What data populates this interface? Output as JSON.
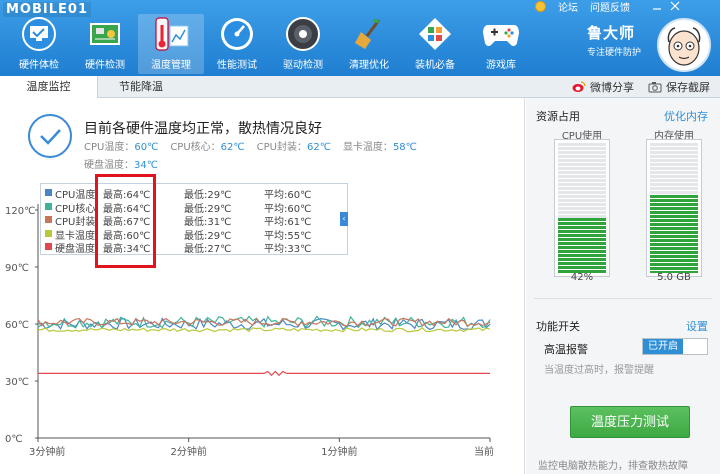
{
  "watermark": "MOBILE01",
  "title_bar": {
    "forum": "论坛",
    "feedback": "问题反馈"
  },
  "toolbar": {
    "items": [
      {
        "label": "硬件体检",
        "icon": "monitor-check-icon"
      },
      {
        "label": "硬件检测",
        "icon": "circuit-board-icon"
      },
      {
        "label": "温度管理",
        "icon": "thermometer-icon"
      },
      {
        "label": "性能测试",
        "icon": "speedometer-icon"
      },
      {
        "label": "驱动检测",
        "icon": "driver-box-icon"
      },
      {
        "label": "清理优化",
        "icon": "broom-icon"
      },
      {
        "label": "装机必备",
        "icon": "apps-grid-icon"
      },
      {
        "label": "游戏库",
        "icon": "gamepad-icon"
      }
    ],
    "active_index": 2
  },
  "brand": {
    "name": "鲁大师",
    "subtitle": "专注硬件防护"
  },
  "tabs": [
    {
      "label": "温度监控"
    },
    {
      "label": "节能降温"
    }
  ],
  "tab_actions": {
    "share": "微博分享",
    "screenshot": "保存截屏"
  },
  "status": {
    "message": "目前各硬件温度均正常，散热情况良好",
    "readings": [
      {
        "label": "CPU温度：",
        "value": "60℃"
      },
      {
        "label": "CPU核心：",
        "value": "62℃"
      },
      {
        "label": "CPU封装：",
        "value": "62℃"
      },
      {
        "label": "显卡温度：",
        "value": "58℃"
      }
    ],
    "disk": {
      "label": "硬盘温度：",
      "value": "34℃"
    }
  },
  "chart_data": {
    "type": "line",
    "y_ticks": [
      "120℃",
      "90℃",
      "60℃",
      "30℃",
      "0℃"
    ],
    "ylim": [
      0,
      120
    ],
    "x_ticks": [
      "3分钟前",
      "2分钟前",
      "1分钟前",
      "当前"
    ],
    "series": [
      {
        "name": "CPU温度",
        "color": "#4a86c6",
        "max": "最高:64℃",
        "min": "最低:29℃",
        "avg": "平均:60℃",
        "level": 60,
        "noise": 3
      },
      {
        "name": "CPU核心",
        "color": "#3fb39a",
        "max": "最高:64℃",
        "min": "最低:29℃",
        "avg": "平均:60℃",
        "level": 61,
        "noise": 3
      },
      {
        "name": "CPU封装",
        "color": "#c8765a",
        "max": "最高:67℃",
        "min": "最低:31℃",
        "avg": "平均:61℃",
        "level": 61,
        "noise": 2
      },
      {
        "name": "显卡温度",
        "color": "#b9c83a",
        "max": "最高:60℃",
        "min": "最低:29℃",
        "avg": "平均:55℃",
        "level": 57,
        "noise": 1
      },
      {
        "name": "硬盘温度",
        "color": "#e0484e",
        "max": "最高:34℃",
        "min": "最低:27℃",
        "avg": "平均:33℃",
        "level": 34,
        "noise": 0
      }
    ]
  },
  "resources": {
    "title": "资源占用",
    "link": "优化内存",
    "cpu": {
      "label": "CPU使用",
      "value": "42%",
      "fraction": 0.42
    },
    "mem": {
      "label": "内存使用",
      "value": "5.0 GB",
      "fraction": 0.6
    }
  },
  "functions": {
    "title": "功能开关",
    "link": "设置",
    "alarm_label": "高温报警",
    "alarm_state": "已开启",
    "alarm_note": "当温度过高时，报警提醒"
  },
  "stress_button": "温度压力测试",
  "footer_note": "监控电脑散热能力，排查散热故障"
}
